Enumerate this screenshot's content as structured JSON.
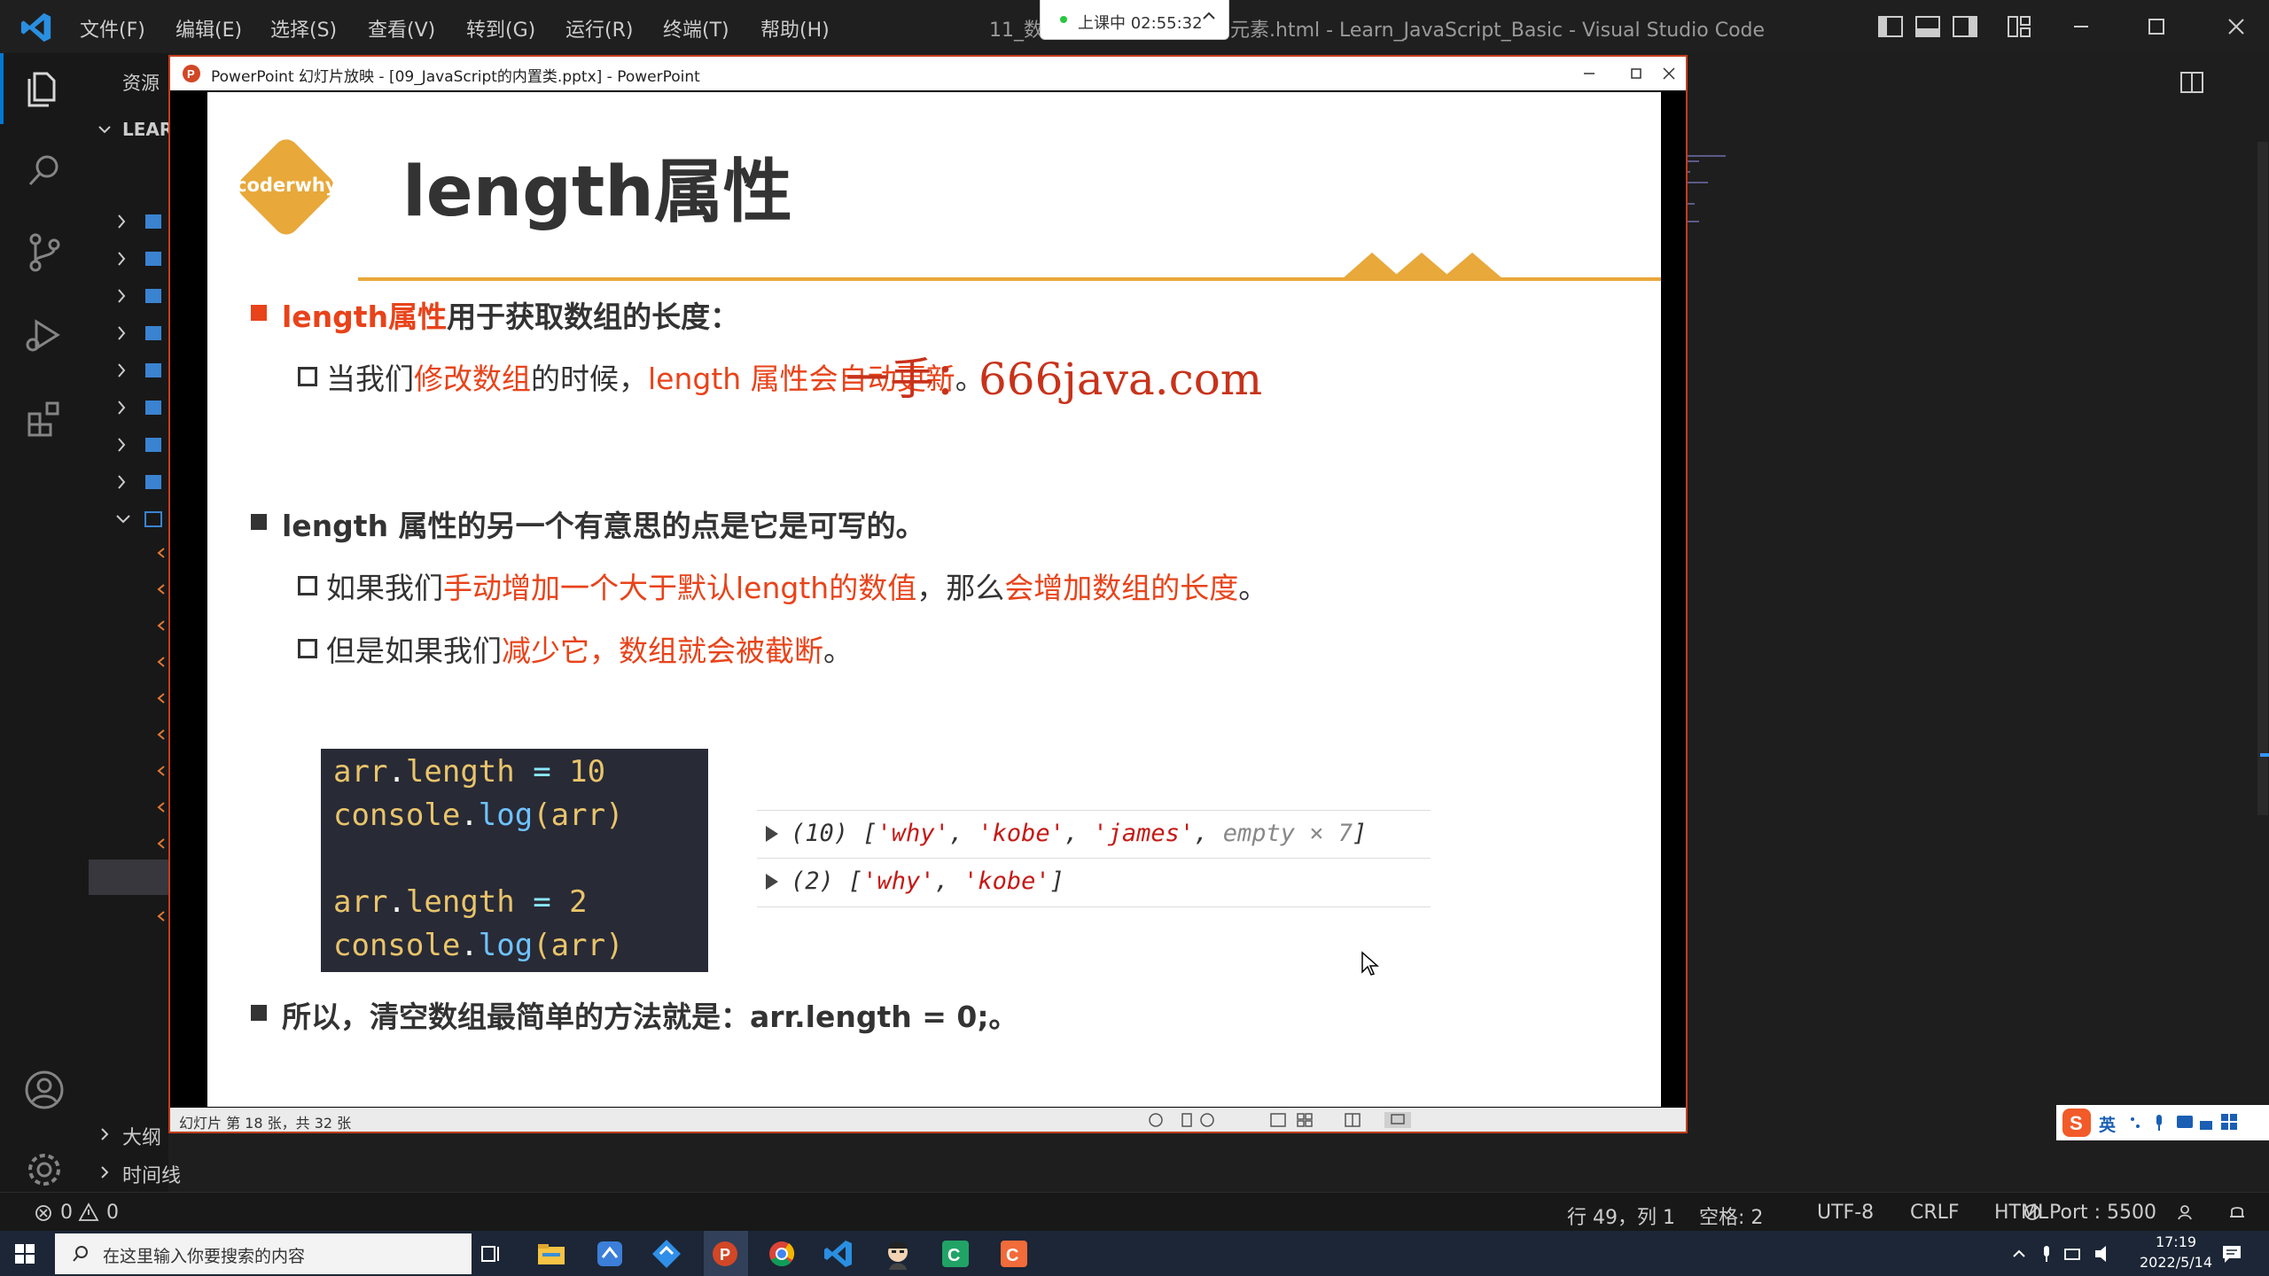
{
  "vscode": {
    "menu": [
      "文件(F)",
      "编辑(E)",
      "选择(S)",
      "查看(V)",
      "转到(G)",
      "运行(R)",
      "终端(T)",
      "帮助(H)"
    ],
    "title_left": "11_数",
    "title_right": "元素.html - Learn_JavaScript_Basic - Visual Studio Code",
    "explorer_label": "资源",
    "explorer_root": "LEAR",
    "outline_label": "大纲",
    "timeline_label": "时间线"
  },
  "recording": {
    "label": "上课中 02:55:32"
  },
  "powerpoint": {
    "title": "PowerPoint 幻灯片放映 - [09_JavaScript的内置类.pptx] - PowerPoint",
    "status": "幻灯片 第 18 张，共 32 张"
  },
  "slide": {
    "logo_text": "coderwhy",
    "title": "length属性",
    "watermark": "一手：666java.com",
    "b1_red": "length属性",
    "b1_rest": "用于获取数组的长度：",
    "b1_sub_a": "当我们",
    "b1_sub_b": "修改数组",
    "b1_sub_c": "的时候，",
    "b1_sub_d": "length 属性会自动更新",
    "b1_sub_e": "。",
    "b2": "length 属性的另一个有意思的点是它是可写的。",
    "b2_sub1_a": "如果我们",
    "b2_sub1_b": "手动增加一个大于默认length的数值",
    "b2_sub1_c": "，那么",
    "b2_sub1_d": "会增加数组的长度",
    "b2_sub1_e": "。",
    "b2_sub2_a": "但是如果我们",
    "b2_sub2_b": "减少它，数组就会被截断",
    "b2_sub2_c": "。",
    "code": [
      {
        "obj": "arr",
        "dot": ".",
        "prop": "length",
        "op": " = ",
        "val": "10"
      },
      {
        "obj": "console",
        "dot": ".",
        "prop": "log",
        "op": "(arr)",
        "val": ""
      },
      {
        "obj": "arr",
        "dot": ".",
        "prop": "length",
        "op": " = ",
        "val": "2"
      },
      {
        "obj": "console",
        "dot": ".",
        "prop": "log",
        "op": "(arr)",
        "val": ""
      }
    ],
    "console_rows": [
      {
        "count": "(10) [",
        "items": [
          "'why'",
          "'kobe'",
          "'james'"
        ],
        "extra": "empty × 7",
        "end": "]"
      },
      {
        "count": "(2) [",
        "items": [
          "'why'",
          "'kobe'"
        ],
        "extra": "",
        "end": "]"
      }
    ],
    "b3": "所以，清空数组最简单的方法就是：arr.length = 0;。"
  },
  "statusbar": {
    "errors": "0",
    "warnings": "0",
    "position": "行 49，列 1",
    "spaces": "空格: 2",
    "encoding": "UTF-8",
    "eol": "CRLF",
    "language": "HTML",
    "port": "Port : 5500"
  },
  "taskbar": {
    "search_placeholder": "在这里输入你要搜索的内容",
    "time": "17:19",
    "date": "2022/5/14"
  },
  "ime": {
    "mode": "英"
  },
  "colors": {
    "accent_red": "#e8431a",
    "logo_gold": "#e8a83a",
    "ppt_red": "#c43e1c",
    "vscode_blue": "#007acc"
  }
}
